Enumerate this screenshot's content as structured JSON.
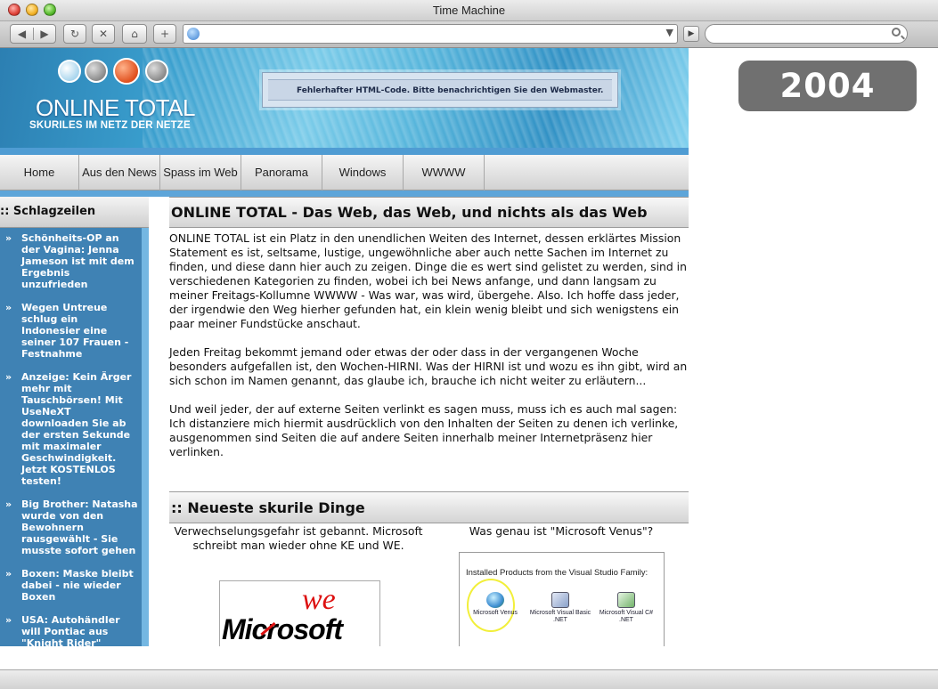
{
  "window": {
    "title": "Time Machine"
  },
  "toolbar": {
    "back_icon": "back-arrow-icon",
    "forward_icon": "forward-arrow-icon",
    "address": "",
    "search_placeholder": ""
  },
  "badge": {
    "year": "2004"
  },
  "site": {
    "logo_title": "ONLINE TOTAL",
    "logo_subtitle": "SKURILES IM NETZ DER NETZE",
    "error_message": "Fehlerhafter HTML-Code. Bitte benachrichtigen Sie den Webmaster."
  },
  "nav": {
    "items": [
      "Home",
      "Aus den News",
      "Spass im Web",
      "Panorama",
      "Windows",
      "WWWW"
    ]
  },
  "sidebar": {
    "title": ":: Schlagzeilen",
    "news": [
      "Schönheits-OP an der Vagina: Jenna Jameson ist mit dem Ergebnis unzufrieden",
      "Wegen Untreue schlug ein Indonesier eine seiner 107 Frauen - Festnahme",
      "Anzeige: Kein Ärger mehr mit Tauschbörsen! Mit UseNeXT downloaden Sie ab der ersten Sekunde mit maximaler Geschwindigkeit. Jetzt KOSTENLOS testen!",
      "Big Brother: Natasha wurde von den Bewohnern rausgewählt - Sie musste sofort gehen",
      "Boxen: Maske bleibt dabei - nie wieder Boxen",
      "USA: Autohändler will Pontiac aus \"Knight Rider\" verkaufen"
    ]
  },
  "main": {
    "heading": "ONLINE TOTAL - Das Web, das Web, und nichts als das Web",
    "paragraphs": [
      "ONLINE TOTAL ist ein Platz in den unendlichen Weiten des Internet, dessen erklärtes Mission Statement es ist, seltsame, lustige, ungewöhnliche aber auch nette Sachen im Internet zu finden, und diese dann hier auch zu zeigen. Dinge die es wert sind gelistet zu werden, sind in verschiedenen Kategorien zu finden, wobei ich bei News anfange, und dann langsam zu meiner Freitags-Kollumne WWWW - Was war, was wird, übergehe. Also. Ich hoffe dass jeder, der irgendwie den Weg hierher gefunden hat, ein klein wenig bleibt und sich wenigstens ein paar meiner Fundstücke anschaut.",
      "Jeden Freitag bekommt jemand oder etwas der oder dass in der vergangenen Woche besonders aufgefallen ist, den Wochen-HIRNI. Was der HIRNI ist und wozu es ihn gibt, wird an sich schon im Namen genannt, das glaube ich, brauche ich nicht weiter zu erläutern...",
      "Und weil jeder, der auf externe Seiten verlinkt es sagen muss, muss ich es auch mal sagen: Ich distanziere mich hiermit ausdrücklich von den Inhalten der Seiten zu denen ich verlinke, ausgenommen sind Seiten die auf andere Seiten innerhalb meiner Internetpräsenz hier verlinken."
    ],
    "section2_heading": ":: Neueste skurile Dinge",
    "item1_text": "Verwechselungsgefahr ist gebannt. Microsoft schreibt man wieder ohne KE und WE.",
    "item1_image": {
      "word": "Microsoft",
      "overlay": "we"
    },
    "item2_text": "Was genau ist \"Microsoft Venus\"?",
    "item2_image": {
      "caption": "Installed Products from the Visual Studio Family:",
      "products": [
        "Microsoft Venus",
        "Microsoft Visual Basic .NET",
        "Microsoft Visual C# .NET"
      ]
    }
  }
}
